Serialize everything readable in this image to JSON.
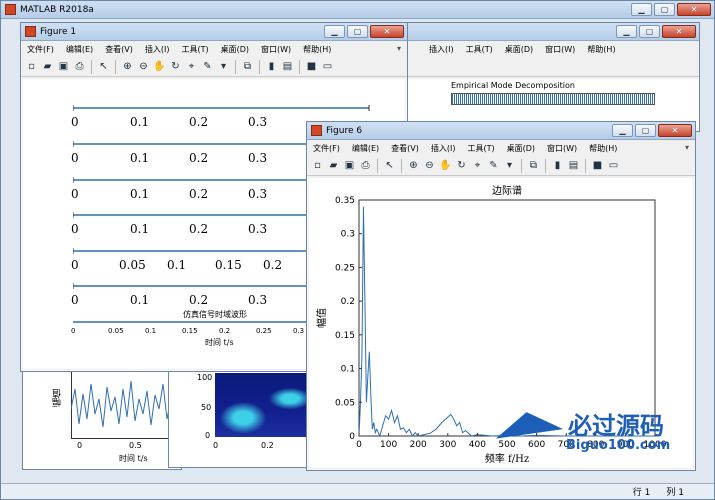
{
  "main": {
    "title": "MATLAB R2018a",
    "status_row": "行",
    "status_row_val": "1",
    "status_col": "列",
    "status_col_val": "1"
  },
  "menu": [
    "文件(F)",
    "编辑(E)",
    "查看(V)",
    "插入(I)",
    "工具(T)",
    "桌面(D)",
    "窗口(W)",
    "帮助(H)"
  ],
  "toolbar_icons": [
    "new-file-icon",
    "open-folder-icon",
    "save-icon",
    "print-icon",
    "sep",
    "pointer-icon",
    "sep",
    "zoom-in-icon",
    "zoom-out-icon",
    "pan-hand-icon",
    "rotate-3d-icon",
    "data-cursor-icon",
    "brush-icon",
    "dropdown-icon",
    "sep",
    "link-icon",
    "sep",
    "colorbar-icon",
    "legend-icon",
    "sep",
    "hide-plot-tools-icon",
    "show-plot-tools-icon"
  ],
  "figure1": {
    "title": "Figure 1",
    "rows": [
      {
        "ticks": [
          "0",
          "0.1",
          "0.2",
          "0.3"
        ]
      },
      {
        "ticks": [
          "0",
          "0.1",
          "0.2",
          "0.3"
        ]
      },
      {
        "ticks": [
          "0",
          "0.1",
          "0.2",
          "0.3"
        ]
      },
      {
        "ticks": [
          "0",
          "0.1",
          "0.2",
          "0.3"
        ]
      },
      {
        "ticks": [
          "0",
          "0.05",
          "0.1",
          "0.15",
          "0.2"
        ]
      },
      {
        "ticks": [
          "0",
          "0.1",
          "0.2",
          "0.3"
        ]
      }
    ],
    "bottom_title": "仿真信号时域波形",
    "bottom_ticks": [
      "0",
      "0.05",
      "0.1",
      "0.15",
      "0.2",
      "0.25",
      "0.3"
    ],
    "bottom_xlabel": "时间 t/s"
  },
  "figure_emd": {
    "title": "Empirical Mode Decomposition"
  },
  "figure_back_left": {
    "ylabel": "幅值",
    "xticks": [
      "0",
      "0.5"
    ],
    "xlabel": "时间 t/s"
  },
  "figure_back_mid": {
    "yticks": [
      "100",
      "50",
      "0"
    ],
    "xticks": [
      "0",
      "0.2"
    ]
  },
  "figure6": {
    "title": "Figure 6"
  },
  "watermark": {
    "title": "必过源码",
    "url": "Biguo100.com"
  },
  "chart_data": {
    "type": "line",
    "title": "边际谱",
    "xlabel": "频率 f/Hz",
    "ylabel": "幅值",
    "xlim": [
      0,
      1000
    ],
    "ylim": [
      0,
      0.35
    ],
    "xticks": [
      "0",
      "100",
      "200",
      "300",
      "400",
      "500",
      "600",
      "700",
      "800",
      "900",
      "1000"
    ],
    "yticks": [
      "0",
      "0.05",
      "0.1",
      "0.15",
      "0.2",
      "0.25",
      "0.3",
      "0.35"
    ],
    "x": [
      0,
      5,
      10,
      15,
      20,
      25,
      30,
      35,
      40,
      45,
      50,
      55,
      60,
      70,
      80,
      90,
      100,
      110,
      120,
      130,
      140,
      150,
      160,
      170,
      180,
      190,
      200,
      220,
      240,
      260,
      280,
      300,
      310,
      320,
      330,
      340,
      350,
      360,
      380,
      400,
      450,
      500,
      550,
      600,
      700,
      800,
      900,
      1000
    ],
    "y": [
      0.0,
      0.05,
      0.12,
      0.34,
      0.2,
      0.05,
      0.09,
      0.125,
      0.06,
      0.01,
      0.02,
      0.005,
      0.01,
      0.0,
      0.015,
      0.03,
      0.025,
      0.038,
      0.02,
      0.03,
      0.01,
      0.012,
      0.005,
      0.01,
      0.0,
      0.005,
      0.0,
      0.002,
      0.004,
      0.01,
      0.02,
      0.028,
      0.032,
      0.025,
      0.015,
      0.02,
      0.005,
      0.008,
      0.0,
      0.002,
      0.0,
      0.001,
      0.0,
      0.001,
      0.0,
      0.0,
      0.0,
      0.0
    ]
  }
}
